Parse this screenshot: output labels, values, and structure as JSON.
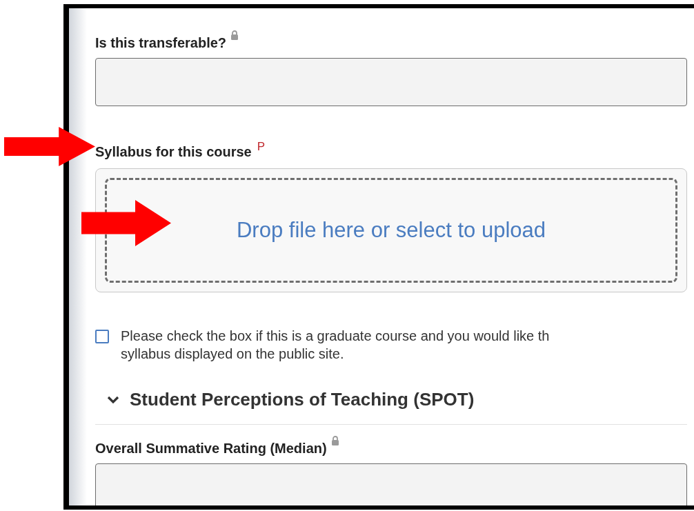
{
  "form": [
    {
      "kind": "locked_field",
      "label": "Is this transferable?",
      "locked": true
    },
    {
      "kind": "upload",
      "label": "Syllabus for this course",
      "marker": "P",
      "prompt": "Drop file here or select to upload"
    },
    {
      "kind": "checkbox",
      "checked": false,
      "lines": [
        "Please check the box if this is a graduate course and you would like th",
        "syllabus displayed on the public site."
      ]
    },
    {
      "kind": "section",
      "title": "Student Perceptions of Teaching (SPOT)",
      "expanded": true
    },
    {
      "kind": "locked_field",
      "label": "Overall Summative Rating (Median)",
      "locked": true
    }
  ],
  "annotations": [
    {
      "kind": "arrow"
    },
    {
      "kind": "arrow"
    }
  ]
}
